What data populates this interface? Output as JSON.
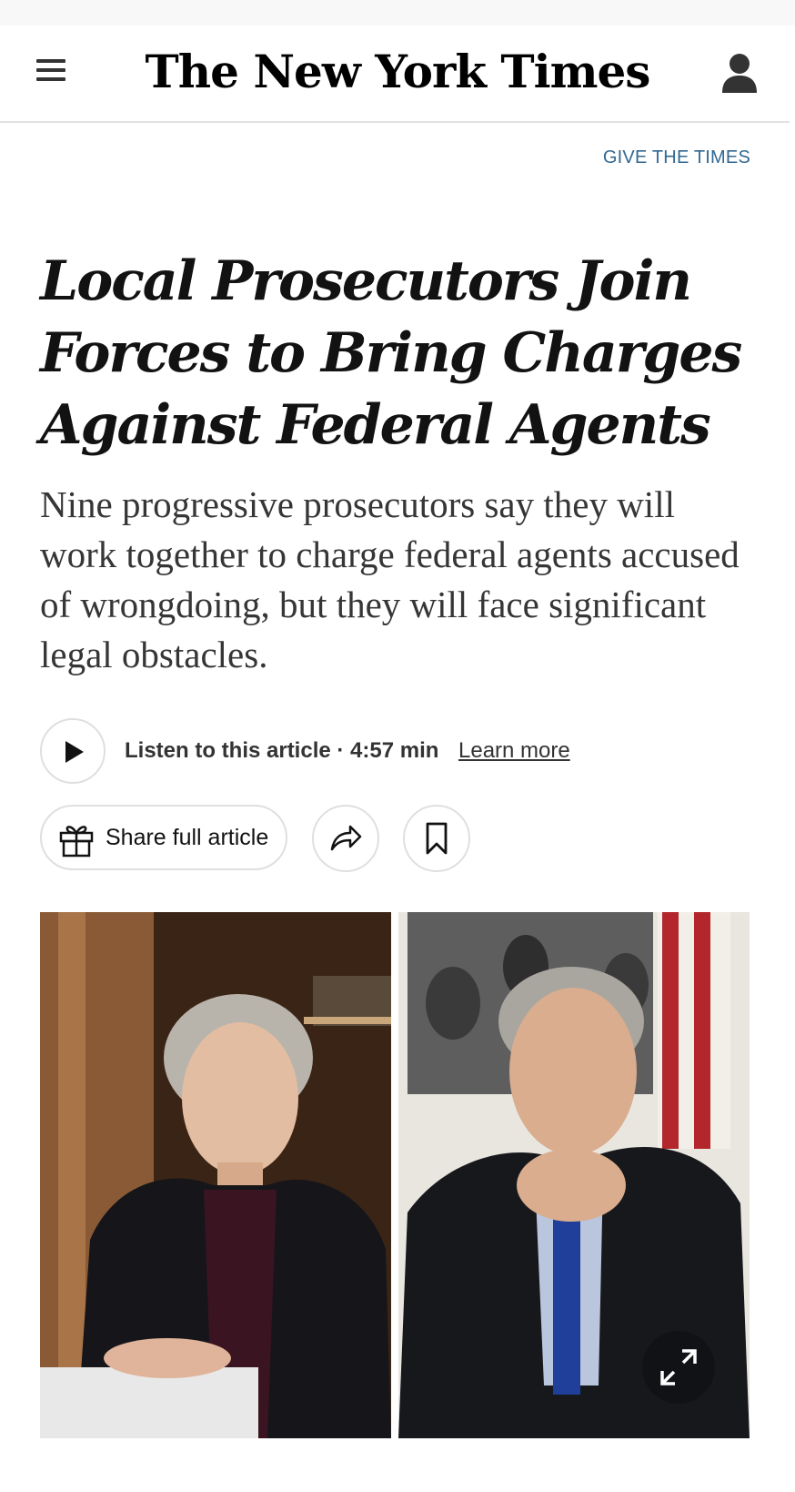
{
  "header": {
    "masthead": "The New York Times",
    "menu_icon": "hamburger-menu-icon",
    "account_icon": "person-icon"
  },
  "promo": {
    "give_label": "GIVE THE TIMES"
  },
  "article": {
    "headline": "Local Prosecutors Join Forces to Bring Charges Against Federal Agents",
    "summary": "Nine progressive prosecutors say they will work together to charge federal agents accused of wrongdoing, but they will face significant legal obstacles.",
    "listen": {
      "label": "Listen to this article · 4:57 min",
      "learn_more": "Learn more",
      "play_icon": "play-icon"
    },
    "actions": {
      "share_label": "Share full article",
      "gift_icon": "gift-icon",
      "share_icon": "share-arrow-icon",
      "save_icon": "bookmark-icon"
    },
    "media": {
      "expand_icon": "expand-icon"
    }
  },
  "colors": {
    "link_blue": "#326891",
    "text_primary": "#121212",
    "text_secondary": "#363636",
    "border": "#dfdfdf"
  }
}
